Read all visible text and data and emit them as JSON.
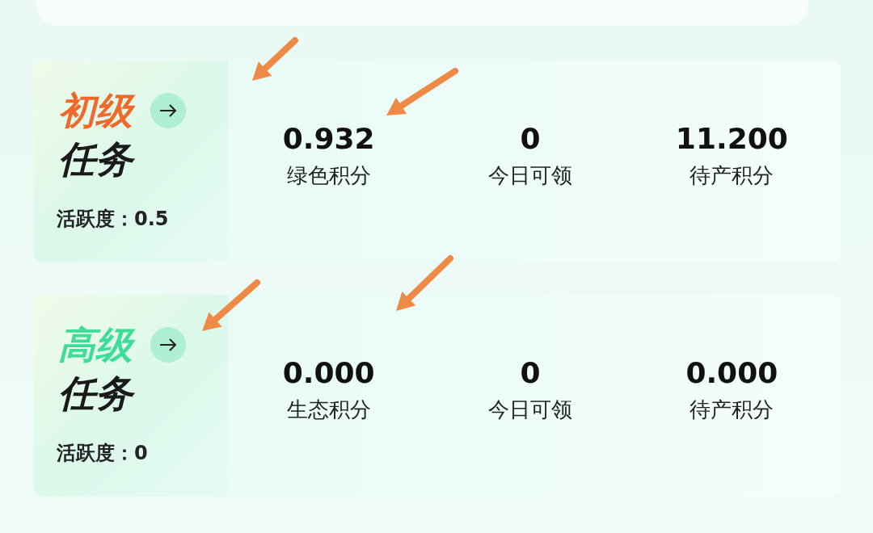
{
  "tasks": [
    {
      "level_label": "初级",
      "title": "任务",
      "color": "#ef6a2a",
      "activity": "活跃度：0.5",
      "stats": [
        {
          "value": "0.932",
          "label": "绿色积分"
        },
        {
          "value": "0",
          "label": "今日可领"
        },
        {
          "value": "11.200",
          "label": "待产积分"
        }
      ]
    },
    {
      "level_label": "高级",
      "title": "任务",
      "color": "#3ddc97",
      "activity": "活跃度：0",
      "stats": [
        {
          "value": "0.000",
          "label": "生态积分"
        },
        {
          "value": "0",
          "label": "今日可领"
        },
        {
          "value": "0.000",
          "label": "待产积分"
        }
      ]
    }
  ]
}
